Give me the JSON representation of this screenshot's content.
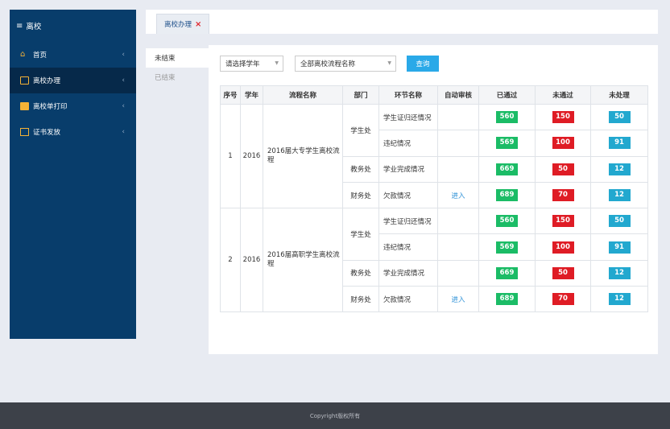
{
  "sidebar": {
    "title": "离校",
    "items": [
      {
        "label": "首页",
        "icon": "home-icon"
      },
      {
        "label": "离校办理",
        "icon": "box-icon"
      },
      {
        "label": "离校单打印",
        "icon": "printer-icon"
      },
      {
        "label": "证书发放",
        "icon": "certificate-icon"
      }
    ]
  },
  "tabs": [
    {
      "label": "离校办理"
    }
  ],
  "subnav": {
    "items": [
      "未结束",
      "已结束"
    ]
  },
  "filters": {
    "year_placeholder": "请选择学年",
    "flow_placeholder": "全部离校流程名称",
    "query_label": "查询"
  },
  "table": {
    "headers": [
      "序号",
      "学年",
      "流程名称",
      "部门",
      "环节名称",
      "自动审核",
      "已通过",
      "未通过",
      "未处理"
    ],
    "groups": [
      {
        "index": "1",
        "year": "2016",
        "flow": "2016届大专学生离校流程",
        "rows": [
          {
            "dept": "学生处",
            "step": "学生证归还情况",
            "auto": "",
            "passed": "560",
            "failed": "150",
            "pending": "50"
          },
          {
            "dept": "",
            "step": "违纪情况",
            "auto": "",
            "passed": "569",
            "failed": "100",
            "pending": "91"
          },
          {
            "dept": "教务处",
            "step": "学业完成情况",
            "auto": "",
            "passed": "669",
            "failed": "50",
            "pending": "12"
          },
          {
            "dept": "财务处",
            "step": "欠款情况",
            "auto": "进入",
            "passed": "689",
            "failed": "70",
            "pending": "12"
          }
        ]
      },
      {
        "index": "2",
        "year": "2016",
        "flow": "2016届高职学生离校流程",
        "rows": [
          {
            "dept": "学生处",
            "step": "学生证归还情况",
            "auto": "",
            "passed": "560",
            "failed": "150",
            "pending": "50"
          },
          {
            "dept": "",
            "step": "违纪情况",
            "auto": "",
            "passed": "569",
            "failed": "100",
            "pending": "91"
          },
          {
            "dept": "教务处",
            "step": "学业完成情况",
            "auto": "",
            "passed": "669",
            "failed": "50",
            "pending": "12"
          },
          {
            "dept": "财务处",
            "step": "欠款情况",
            "auto": "进入",
            "passed": "689",
            "failed": "70",
            "pending": "12"
          }
        ]
      }
    ]
  },
  "footer": {
    "text": "Copyright版权所有"
  },
  "colors": {
    "sidebar": "#083d6b",
    "passed": "#1bbc66",
    "failed": "#df1c25",
    "pending": "#22a8cf",
    "accent": "#2aa9e8"
  }
}
